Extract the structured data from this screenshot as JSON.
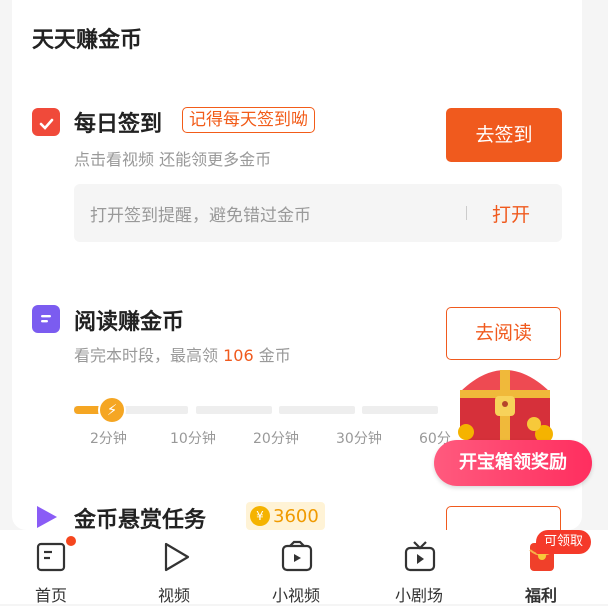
{
  "section_title": "天天赚金币",
  "checkin": {
    "title": "每日签到",
    "tag": "记得每天签到呦",
    "subtitle": "点击看视频 还能领更多金币",
    "button": "去签到",
    "reminder_text": "打开签到提醒，避免错过金币",
    "reminder_button": "打开",
    "icon_color": "#f04a3a"
  },
  "read": {
    "title": "阅读赚金币",
    "subtitle_prefix": "看完本时段，最高领 ",
    "subtitle_amount": "106",
    "subtitle_suffix": " 金币",
    "button": "去阅读",
    "icon_color": "#7b5cf0",
    "progress_ticks": [
      "2分钟",
      "10分钟",
      "20分钟",
      "30分钟",
      "60分"
    ],
    "progress_stage_reached": 1
  },
  "bounty": {
    "title": "金币悬赏任务",
    "coin_amount": "3600",
    "icon_color": "#8a5cf6"
  },
  "treasure": {
    "claim_button": "开宝箱领奖励"
  },
  "nav": {
    "items": [
      {
        "label": "首页",
        "icon": "book-icon"
      },
      {
        "label": "视频",
        "icon": "play-icon"
      },
      {
        "label": "小视频",
        "icon": "camera-icon"
      },
      {
        "label": "小剧场",
        "icon": "tv-icon"
      },
      {
        "label": "福利",
        "icon": "red-packet-icon"
      }
    ],
    "claim_badge": "可领取"
  },
  "colors": {
    "accent": "#f05a1e",
    "coin": "#f5a623",
    "claim_pink": "#ff3a68"
  }
}
